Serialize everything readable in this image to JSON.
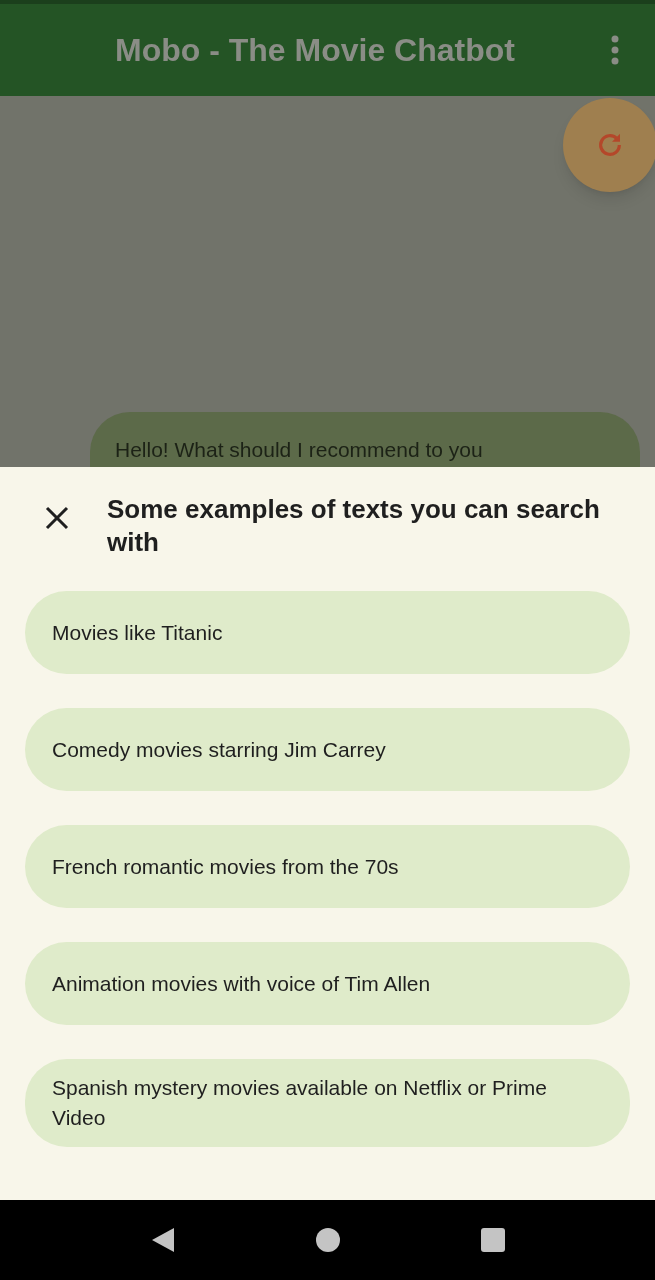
{
  "app_bar": {
    "title": "Mobo - The Movie Chatbot"
  },
  "chat": {
    "messages": [
      {
        "text": "Hello! What should I recommend to you"
      }
    ]
  },
  "sheet": {
    "title": "Some examples of texts you can search with",
    "examples": [
      {
        "text": "Movies like Titanic"
      },
      {
        "text": "Comedy movies starring Jim Carrey"
      },
      {
        "text": "French romantic movies from the 70s"
      },
      {
        "text": "Animation movies with voice of Tim Allen"
      },
      {
        "text": "Spanish mystery movies available on Netflix or Prime Video"
      }
    ]
  }
}
